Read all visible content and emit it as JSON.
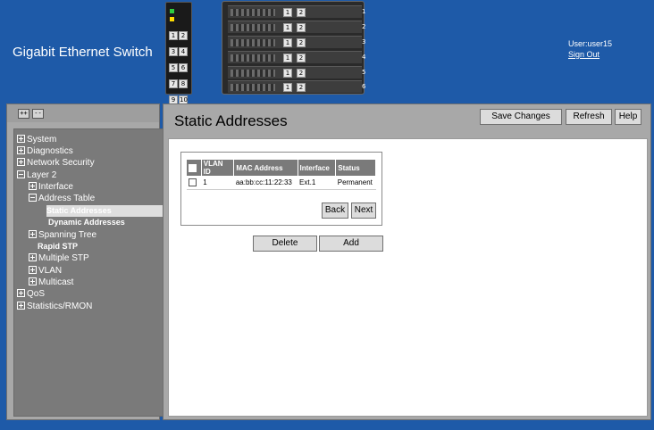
{
  "header": {
    "app_title": "Gigabit Ethernet Switch",
    "user_label": "User:user15",
    "sign_out": "Sign Out"
  },
  "switch_small": {
    "ports": [
      "1",
      "2",
      "3",
      "4",
      "5",
      "6",
      "7",
      "8",
      "9",
      "10"
    ]
  },
  "chassis": {
    "blades": [
      {
        "a": "1",
        "b": "2",
        "num": "1"
      },
      {
        "a": "1",
        "b": "2",
        "num": "2"
      },
      {
        "a": "1",
        "b": "2",
        "num": "3"
      },
      {
        "a": "1",
        "b": "2",
        "num": "4"
      },
      {
        "a": "1",
        "b": "2",
        "num": "5"
      },
      {
        "a": "1",
        "b": "2",
        "num": "6"
      }
    ]
  },
  "nav": {
    "expand_all": "++",
    "collapse_all": "--",
    "items": [
      {
        "label": "System"
      },
      {
        "label": "Diagnostics"
      },
      {
        "label": "Network Security"
      },
      {
        "label": "Layer 2"
      },
      {
        "label": "Interface"
      },
      {
        "label": "Address Table"
      },
      {
        "label": "Static Addresses"
      },
      {
        "label": "Dynamic Addresses"
      },
      {
        "label": "Spanning Tree"
      },
      {
        "label": "Rapid STP"
      },
      {
        "label": "Multiple STP"
      },
      {
        "label": "VLAN"
      },
      {
        "label": "Multicast"
      },
      {
        "label": "QoS"
      },
      {
        "label": "Statistics/RMON"
      }
    ]
  },
  "main": {
    "title": "Static Addresses",
    "save_changes": "Save Changes",
    "refresh": "Refresh",
    "help": "Help",
    "table": {
      "headers": [
        "VLAN ID",
        "MAC Address",
        "Interface",
        "Status"
      ],
      "rows": [
        {
          "vlan": "1",
          "mac": "aa:bb:cc:11:22:33",
          "interface": "Ext.1",
          "status": "Permanent"
        }
      ]
    },
    "back": "Back",
    "next": "Next",
    "delete": "Delete",
    "add": "Add"
  },
  "colors": {
    "header_bg": "#1e5aa8",
    "panel_bg": "#a8a8a8",
    "tree_bg": "#7a7a7a"
  }
}
